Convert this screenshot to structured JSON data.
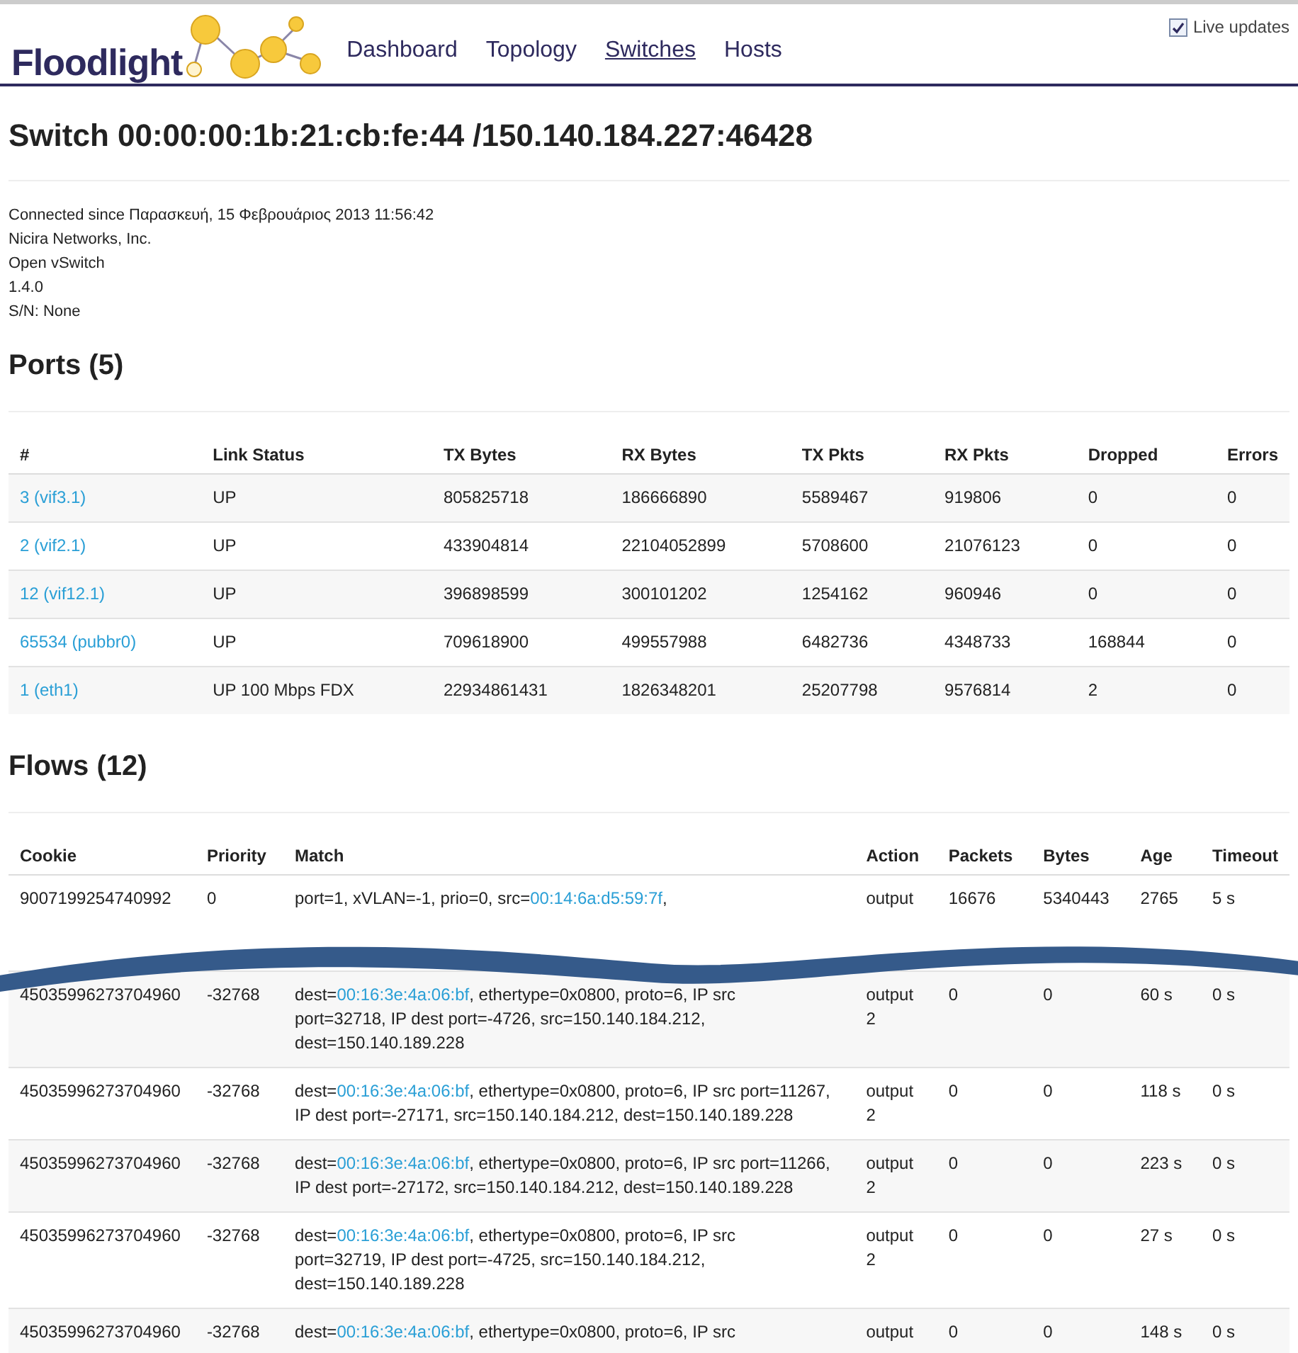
{
  "header": {
    "logo": "Floodlight",
    "nav": [
      {
        "label": "Dashboard",
        "selected": false
      },
      {
        "label": "Topology",
        "selected": false
      },
      {
        "label": "Switches",
        "selected": true
      },
      {
        "label": "Hosts",
        "selected": false
      }
    ],
    "live_updates": {
      "label": "Live updates",
      "checked": true
    }
  },
  "title": "Switch 00:00:00:1b:21:cb:fe:44 /150.140.184.227:46428",
  "info": [
    "Connected since Παρασκευή, 15 Φεβρουάριος 2013 11:56:42",
    "Nicira Networks, Inc.",
    "Open vSwitch",
    "1.4.0",
    "S/N: None"
  ],
  "ports": {
    "heading": "Ports (5)",
    "columns": [
      "#",
      "Link Status",
      "TX Bytes",
      "RX Bytes",
      "TX Pkts",
      "RX Pkts",
      "Dropped",
      "Errors"
    ],
    "rows": [
      [
        "3 (vif3.1)",
        "UP",
        "805825718",
        "186666890",
        "5589467",
        "919806",
        "0",
        "0"
      ],
      [
        "2 (vif2.1)",
        "UP",
        "433904814",
        "22104052899",
        "5708600",
        "21076123",
        "0",
        "0"
      ],
      [
        "12 (vif12.1)",
        "UP",
        "396898599",
        "300101202",
        "1254162",
        "960946",
        "0",
        "0"
      ],
      [
        "65534 (pubbr0)",
        "UP",
        "709618900",
        "499557988",
        "6482736",
        "4348733",
        "168844",
        "0"
      ],
      [
        "1 (eth1)",
        "UP 100 Mbps FDX",
        "22934861431",
        "1826348201",
        "25207798",
        "9576814",
        "2",
        "0"
      ]
    ]
  },
  "flows": {
    "heading": "Flows (12)",
    "columns": [
      "Cookie",
      "Priority",
      "Match",
      "Action",
      "Packets",
      "Bytes",
      "Age",
      "Timeout"
    ],
    "rows": [
      {
        "cookie": "9007199254740992",
        "priority": "0",
        "match": {
          "prefix": "port=1, xVLAN=-1, prio=0, src=",
          "mac": "00:14:6a:d5:59:7f",
          "rest": ","
        },
        "action": [
          "output"
        ],
        "packets": "16676",
        "bytes": "5340443",
        "age": "2765",
        "timeout": "5 s"
      },
      {
        "cookie": "45035996273704960",
        "priority": "-32768",
        "match": {
          "prefix": "dest=",
          "mac": "00:16:3e:4a:06:bf",
          "rest": ", ethertype=0x0800, proto=6, IP src",
          "more": [
            "port=32718, IP dest port=-4726, src=150.140.184.212,",
            "dest=150.140.189.228"
          ]
        },
        "action": [
          "output",
          "2"
        ],
        "packets": "0",
        "bytes": "0",
        "age": "60 s",
        "timeout": "0 s"
      },
      {
        "cookie": "45035996273704960",
        "priority": "-32768",
        "match": {
          "prefix": "dest=",
          "mac": "00:16:3e:4a:06:bf",
          "rest": ", ethertype=0x0800, proto=6, IP src port=11267,",
          "more": [
            "IP dest port=-27171, src=150.140.184.212, dest=150.140.189.228"
          ]
        },
        "action": [
          "output",
          "2"
        ],
        "packets": "0",
        "bytes": "0",
        "age": "118 s",
        "timeout": "0 s"
      },
      {
        "cookie": "45035996273704960",
        "priority": "-32768",
        "match": {
          "prefix": "dest=",
          "mac": "00:16:3e:4a:06:bf",
          "rest": ", ethertype=0x0800, proto=6, IP src port=11266,",
          "more": [
            "IP dest port=-27172, src=150.140.184.212, dest=150.140.189.228"
          ]
        },
        "action": [
          "output",
          "2"
        ],
        "packets": "0",
        "bytes": "0",
        "age": "223 s",
        "timeout": "0 s"
      },
      {
        "cookie": "45035996273704960",
        "priority": "-32768",
        "match": {
          "prefix": "dest=",
          "mac": "00:16:3e:4a:06:bf",
          "rest": ", ethertype=0x0800, proto=6, IP src",
          "more": [
            "port=32719, IP dest port=-4725, src=150.140.184.212,",
            "dest=150.140.189.228"
          ]
        },
        "action": [
          "output",
          "2"
        ],
        "packets": "0",
        "bytes": "0",
        "age": "27 s",
        "timeout": "0 s"
      },
      {
        "cookie": "45035996273704960",
        "priority": "-32768",
        "match": {
          "prefix": "dest=",
          "mac": "00:16:3e:4a:06:bf",
          "rest": ", ethertype=0x0800, proto=6, IP src"
        },
        "action": [
          "output"
        ],
        "packets": "0",
        "bytes": "0",
        "age": "148 s",
        "timeout": "0 s"
      }
    ]
  }
}
